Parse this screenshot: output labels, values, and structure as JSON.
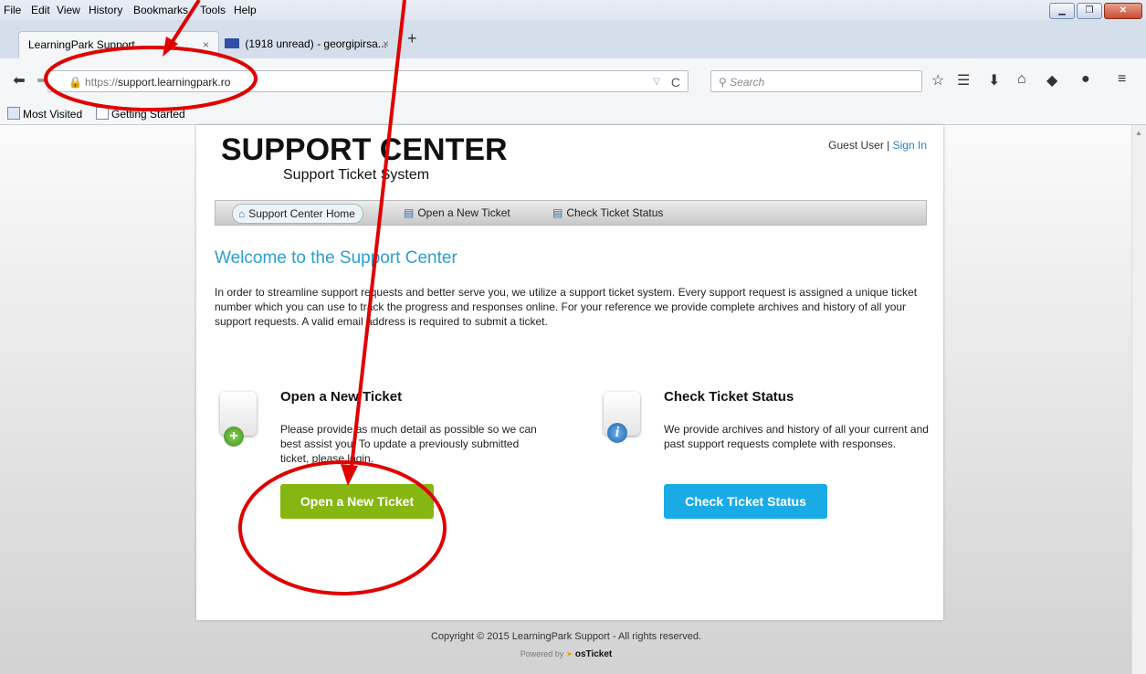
{
  "menu": [
    "File",
    "Edit",
    "View",
    "History",
    "Bookmarks",
    "Tools",
    "Help"
  ],
  "tabs": [
    {
      "label": "LearningPark Support",
      "close": "×"
    },
    {
      "label": "(1918 unread) - georgipirsa...",
      "close": "×"
    }
  ],
  "new_tab": "+",
  "address": {
    "scheme": "https://",
    "host": "support.learningpark.ro"
  },
  "search_placeholder": "Search",
  "bookmarks": [
    "Most Visited",
    "Getting Started"
  ],
  "site": {
    "logo_title": "SUPPORT CENTER",
    "logo_subtitle": "Support Ticket System",
    "guest": "Guest User |",
    "sign_in": "Sign In",
    "nav": [
      "Support Center Home",
      "Open a New Ticket",
      "Check Ticket Status"
    ],
    "welcome": "Welcome to the Support Center",
    "intro": "In order to streamline support requests and better serve you, we utilize a support ticket system. Every support request is assigned a unique ticket number which you can use to track the progress and responses online. For your reference we provide complete archives and history of all your support requests. A valid email address is required to submit a ticket.",
    "open_title": "Open a New Ticket",
    "open_text": "Please provide as much detail as possible so we can best assist you. To update a previously submitted ticket, please login.",
    "open_button": "Open a New Ticket",
    "check_title": "Check Ticket Status",
    "check_text": "We provide archives and history of all your current and past support requests complete with responses.",
    "check_button": "Check Ticket Status",
    "copyright": "Copyright © 2015 LearningPark Support - All rights reserved.",
    "powered_by": "Powered by",
    "powered_brand": "osTicket"
  },
  "colors": {
    "annotation": "#e00000",
    "accent_blue": "#2aa0cf",
    "green_button": "#86b612",
    "blue_button": "#1aabe6"
  }
}
